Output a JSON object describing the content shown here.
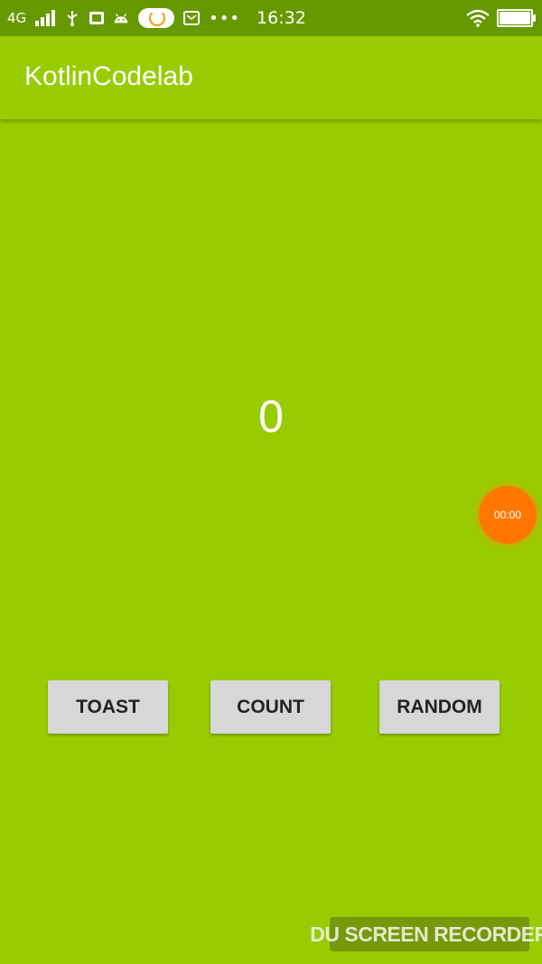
{
  "status_bar": {
    "network_type": "4G",
    "time": "16:32",
    "overflow_dots": "•••",
    "icons": [
      "signal-icon",
      "usb-icon",
      "sim-icon",
      "android-icon",
      "cloud-icon",
      "mail-icon",
      "wifi-icon",
      "battery-icon"
    ]
  },
  "app_bar": {
    "title": "KotlinCodelab"
  },
  "main": {
    "counter_value": "0"
  },
  "buttons": {
    "toast": "TOAST",
    "count": "COUNT",
    "random": "RANDOM"
  },
  "recorder": {
    "timer": "00:00",
    "watermark": "DU SCREEN RECORDER"
  },
  "colors": {
    "primary": "#99CC00",
    "primary_dark": "#669900",
    "button_bg": "#D6D7D7",
    "recorder_fab": "#FF7700"
  }
}
